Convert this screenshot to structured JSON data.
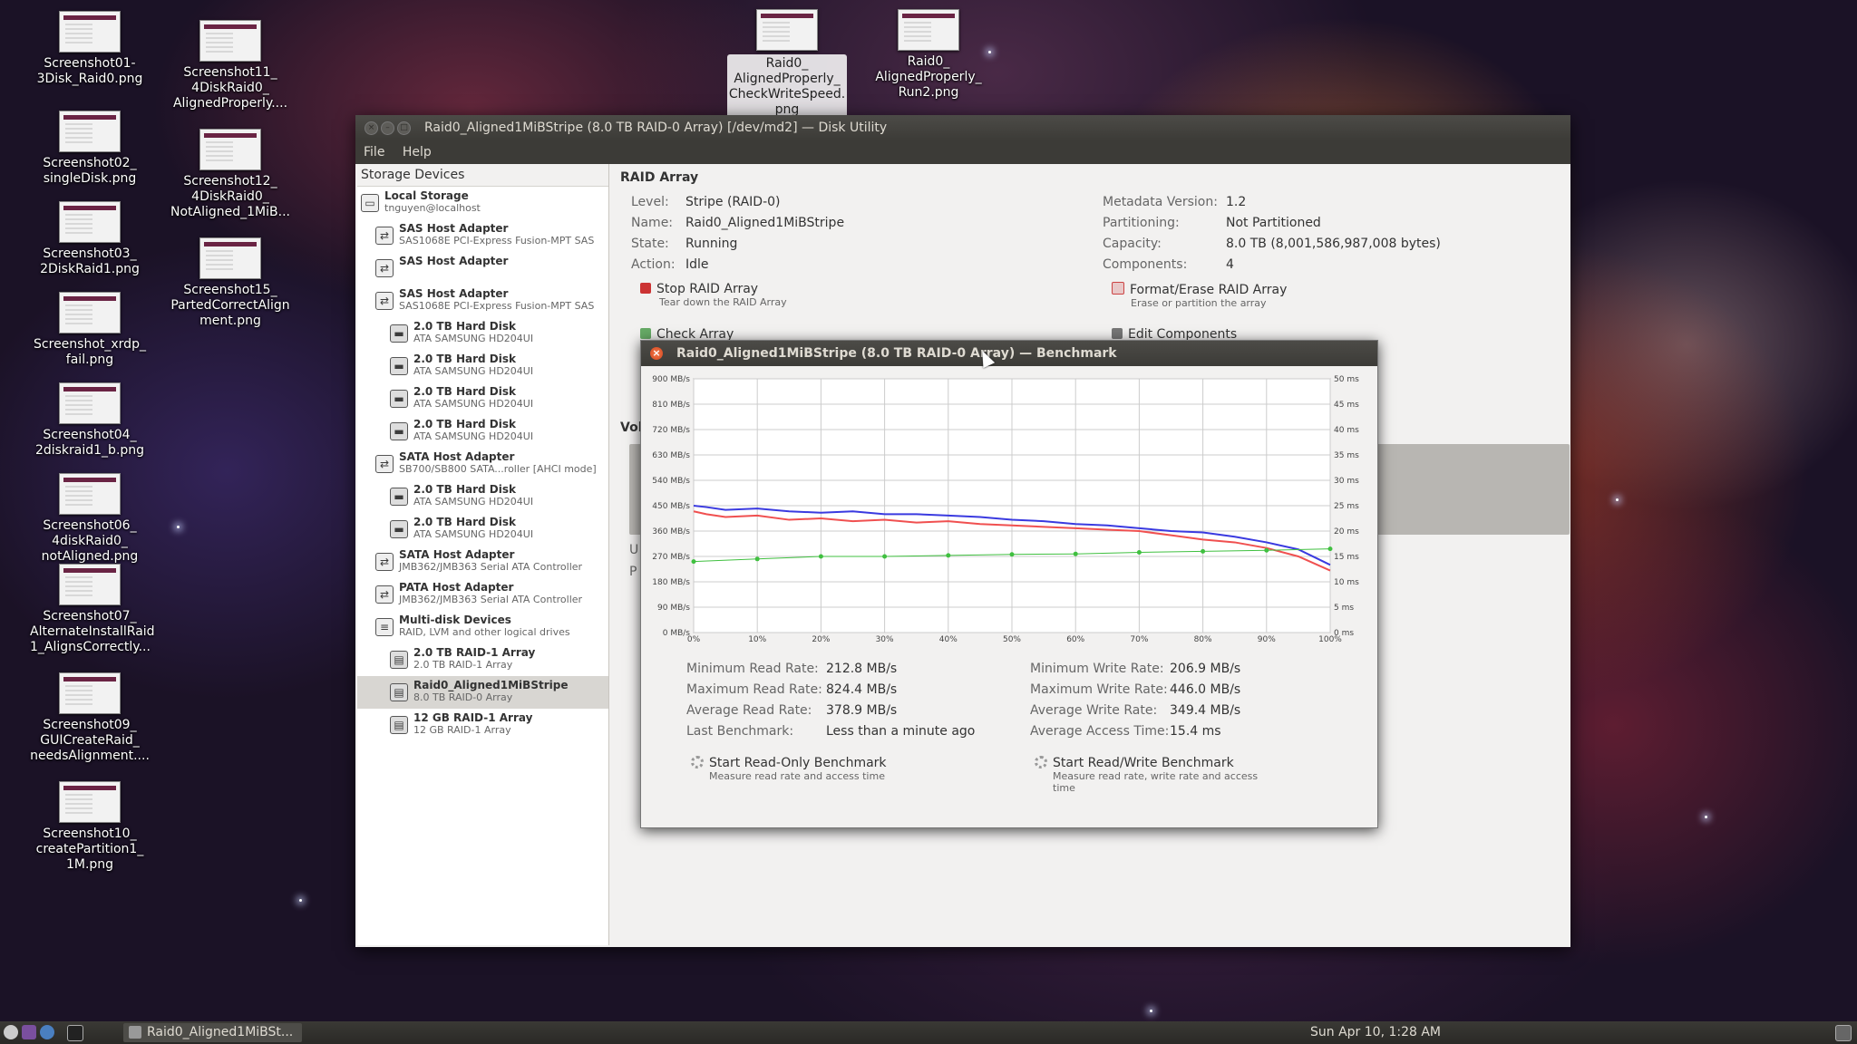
{
  "desktop": {
    "icons": [
      {
        "label": "Screenshot01-\n3Disk_Raid0.png"
      },
      {
        "label": "Screenshot02_\nsingleDisk.png"
      },
      {
        "label": "Screenshot03_\n2DiskRaid1.png"
      },
      {
        "label": "Screenshot_xrdp_\nfail.png"
      },
      {
        "label": "Screenshot04_\n2diskraid1_b.png"
      },
      {
        "label": "Screenshot06_\n4diskRaid0_\nnotAligned.png"
      },
      {
        "label": "Screenshot07_\nAlternateInstallRaid\n1_AlignsCorrectly..."
      },
      {
        "label": "Screenshot09_\nGUICreateRaid_\nneedsAlignment...."
      },
      {
        "label": "Screenshot10_\ncreatePartition1_\n1M.png"
      },
      {
        "label": "Screenshot11_\n4DiskRaid0_\nAlignedProperly...."
      },
      {
        "label": "Screenshot12_\n4DiskRaid0_\nNotAligned_1MiB..."
      },
      {
        "label": "Screenshot15_\nPartedCorrectAlign\nment.png"
      },
      {
        "label": "Raid0_\nAlignedProperly_\nCheckWriteSpeed.\npng"
      },
      {
        "label": "Raid0_\nAlignedProperly_\nRun2.png"
      }
    ]
  },
  "window": {
    "title": "Raid0_Aligned1MiBStripe (8.0 TB RAID-0 Array) [/dev/md2] — Disk Utility",
    "menu": [
      "File",
      "Help"
    ]
  },
  "sidebar": {
    "header": "Storage Devices",
    "items": [
      {
        "name": "Local Storage",
        "desc": "tnguyen@localhost",
        "icon": "computer-icon"
      },
      {
        "name": "SAS Host Adapter",
        "desc": "SAS1068E PCI-Express Fusion-MPT SAS",
        "icon": "adapter-icon"
      },
      {
        "name": "SAS Host Adapter",
        "desc": "",
        "icon": "adapter-icon"
      },
      {
        "name": "SAS Host Adapter",
        "desc": "SAS1068E PCI-Express Fusion-MPT SAS",
        "icon": "adapter-icon"
      },
      {
        "name": "2.0 TB Hard Disk",
        "desc": "ATA SAMSUNG HD204UI",
        "icon": "hard-disk-icon"
      },
      {
        "name": "2.0 TB Hard Disk",
        "desc": "ATA SAMSUNG HD204UI",
        "icon": "hard-disk-icon"
      },
      {
        "name": "2.0 TB Hard Disk",
        "desc": "ATA SAMSUNG HD204UI",
        "icon": "hard-disk-icon"
      },
      {
        "name": "2.0 TB Hard Disk",
        "desc": "ATA SAMSUNG HD204UI",
        "icon": "hard-disk-icon"
      },
      {
        "name": "SATA Host Adapter",
        "desc": "SB700/SB800 SATA...roller [AHCI mode]",
        "icon": "adapter-icon"
      },
      {
        "name": "2.0 TB Hard Disk",
        "desc": "ATA SAMSUNG HD204UI",
        "icon": "hard-disk-icon"
      },
      {
        "name": "2.0 TB Hard Disk",
        "desc": "ATA SAMSUNG HD204UI",
        "icon": "hard-disk-icon"
      },
      {
        "name": "SATA Host Adapter",
        "desc": "JMB362/JMB363 Serial ATA Controller",
        "icon": "adapter-icon"
      },
      {
        "name": "PATA Host Adapter",
        "desc": "JMB362/JMB363 Serial ATA Controller",
        "icon": "adapter-icon"
      },
      {
        "name": "Multi-disk Devices",
        "desc": "RAID, LVM and other logical drives",
        "icon": "multidisk-icon"
      },
      {
        "name": "2.0 TB RAID-1 Array",
        "desc": "2.0 TB RAID-1 Array",
        "icon": "raid-icon"
      },
      {
        "name": "Raid0_Aligned1MiBStripe",
        "desc": "8.0 TB RAID-0 Array",
        "icon": "raid-icon"
      },
      {
        "name": "12 GB RAID-1 Array",
        "desc": "12 GB RAID-1 Array",
        "icon": "raid-icon"
      }
    ]
  },
  "raid": {
    "section_title": "RAID Array",
    "level_label": "Level:",
    "level": "Stripe (RAID-0)",
    "name_label": "Name:",
    "name": "Raid0_Aligned1MiBStripe",
    "state_label": "State:",
    "state": "Running",
    "action_label": "Action:",
    "action": "Idle",
    "meta_label": "Metadata Version:",
    "meta": "1.2",
    "part_label": "Partitioning:",
    "part": "Not Partitioned",
    "cap_label": "Capacity:",
    "cap": "8.0 TB (8,001,586,987,008 bytes)",
    "comp_label": "Components:",
    "comp": "4",
    "stop_title": "Stop RAID Array",
    "stop_sub": "Tear down the RAID Array",
    "format_title": "Format/Erase RAID Array",
    "format_sub": "Erase or partition the array",
    "check_title": "Check Array",
    "edit_title": "Edit Components",
    "vol_label": "Vol",
    "u_label": "U",
    "p_label": "P"
  },
  "benchmark": {
    "title": "Raid0_Aligned1MiBStripe (8.0 TB RAID-0 Array) — Benchmark",
    "min_read_label": "Minimum Read Rate:",
    "min_read": "212.8 MB/s",
    "max_read_label": "Maximum Read Rate:",
    "max_read": "824.4 MB/s",
    "avg_read_label": "Average Read Rate:",
    "avg_read": "378.9 MB/s",
    "last_label": "Last Benchmark:",
    "last": "Less than a minute ago",
    "min_write_label": "Minimum Write Rate:",
    "min_write": "206.9 MB/s",
    "max_write_label": "Maximum Write Rate:",
    "max_write": "446.0 MB/s",
    "avg_write_label": "Average Write Rate:",
    "avg_write": "349.4 MB/s",
    "access_label": "Average Access Time:",
    "access": "15.4 ms",
    "ro_title": "Start Read-Only Benchmark",
    "ro_sub": "Measure read rate and access time",
    "rw_title": "Start Read/Write Benchmark",
    "rw_sub": "Measure read rate, write rate and access time"
  },
  "chart_data": {
    "type": "line",
    "x_ticks": [
      "0%",
      "10%",
      "20%",
      "30%",
      "40%",
      "50%",
      "60%",
      "70%",
      "80%",
      "90%",
      "100%"
    ],
    "y_left_ticks": [
      "0 MB/s",
      "90 MB/s",
      "180 MB/s",
      "270 MB/s",
      "360 MB/s",
      "450 MB/s",
      "540 MB/s",
      "630 MB/s",
      "720 MB/s",
      "810 MB/s",
      "900 MB/s"
    ],
    "y_right_ticks": [
      "0 ms",
      "5 ms",
      "10 ms",
      "15 ms",
      "20 ms",
      "25 ms",
      "30 ms",
      "35 ms",
      "40 ms",
      "45 ms",
      "50 ms"
    ],
    "ylim_left": [
      0,
      900
    ],
    "ylim_right": [
      0,
      50
    ],
    "series": [
      {
        "color": "#3a3ae0",
        "x": [
          0,
          2,
          5,
          10,
          15,
          20,
          25,
          30,
          35,
          40,
          45,
          50,
          55,
          60,
          65,
          70,
          75,
          80,
          85,
          90,
          95,
          100
        ],
        "values": [
          450,
          445,
          435,
          440,
          430,
          425,
          430,
          420,
          420,
          415,
          410,
          400,
          395,
          385,
          380,
          370,
          360,
          355,
          340,
          320,
          295,
          240
        ]
      },
      {
        "color": "#f05050",
        "x": [
          0,
          2,
          5,
          10,
          15,
          20,
          25,
          30,
          35,
          40,
          45,
          50,
          55,
          60,
          65,
          70,
          75,
          80,
          85,
          90,
          95,
          100
        ],
        "values": [
          430,
          420,
          410,
          415,
          400,
          405,
          395,
          400,
          390,
          395,
          385,
          380,
          375,
          370,
          365,
          360,
          345,
          330,
          320,
          300,
          270,
          220
        ]
      },
      {
        "color": "#40c040",
        "x": [
          0,
          10,
          20,
          30,
          40,
          50,
          60,
          70,
          80,
          90,
          100
        ],
        "values": [
          14,
          14.5,
          15,
          15,
          15.2,
          15.4,
          15.5,
          15.8,
          16,
          16.2,
          16.5
        ]
      }
    ]
  },
  "taskbar": {
    "task": "Raid0_Aligned1MiBSt...",
    "clock": "Sun Apr 10,  1:28 AM"
  }
}
